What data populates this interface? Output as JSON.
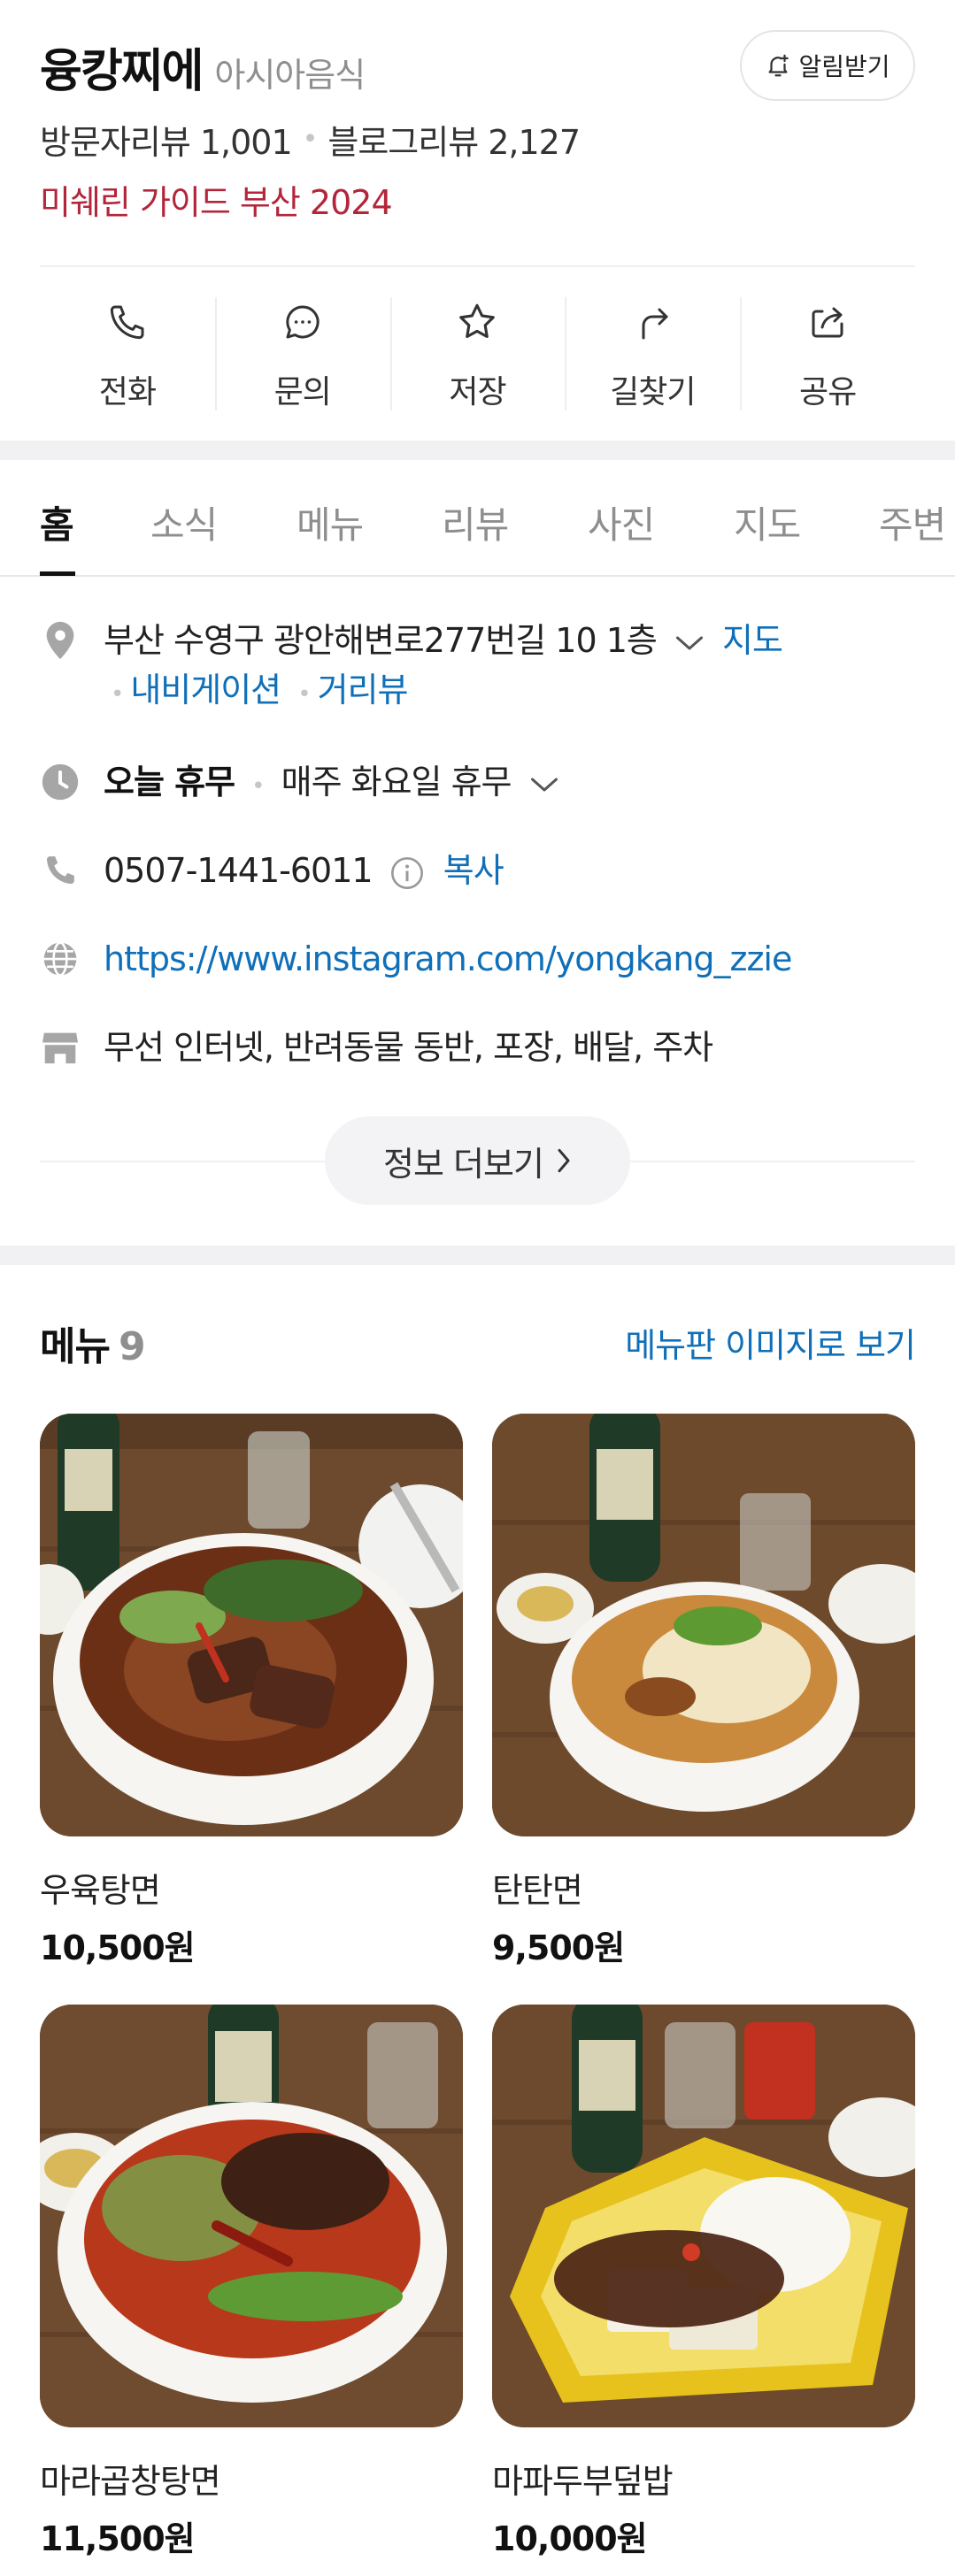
{
  "header": {
    "name": "융캉찌에",
    "category": "아시아음식",
    "alarm_label": "알림받기",
    "visitor_review_label": "방문자리뷰 1,001",
    "blog_review_label": "블로그리뷰 2,127",
    "badge": "미쉐린 가이드 부산 2024"
  },
  "actions": [
    {
      "label": "전화",
      "icon": "phone-icon"
    },
    {
      "label": "문의",
      "icon": "chat-icon"
    },
    {
      "label": "저장",
      "icon": "star-icon"
    },
    {
      "label": "길찾기",
      "icon": "directions-icon"
    },
    {
      "label": "공유",
      "icon": "share-icon"
    }
  ],
  "tabs": [
    "홈",
    "소식",
    "메뉴",
    "리뷰",
    "사진",
    "지도",
    "주변"
  ],
  "info": {
    "address": "부산 수영구 광안해변로277번길 10 1층",
    "map_link": "지도",
    "navigation_link": "내비게이션",
    "street_view_link": "거리뷰",
    "hours_status": "오늘 휴무",
    "hours_detail": "매주 화요일 휴무",
    "phone": "0507-1441-6011",
    "copy_label": "복사",
    "website": "https://www.instagram.com/yongkang_zzie",
    "amenities": "무선 인터넷, 반려동물 동반, 포장, 배달, 주차",
    "more_label": "정보 더보기"
  },
  "menu": {
    "title": "메뉴",
    "count": "9",
    "image_link": "메뉴판 이미지로 보기",
    "items": [
      {
        "name": "우육탕면",
        "price": "10,500원"
      },
      {
        "name": "탄탄면",
        "price": "9,500원"
      },
      {
        "name": "마라곱창탕면",
        "price": "11,500원"
      },
      {
        "name": "마파두부덮밥",
        "price": "10,000원"
      }
    ]
  },
  "colors": {
    "accent_blue": "#0f6fb8",
    "michelin_red": "#b3253a",
    "text_dark": "#111111",
    "text_gray": "#8f8f8f"
  }
}
